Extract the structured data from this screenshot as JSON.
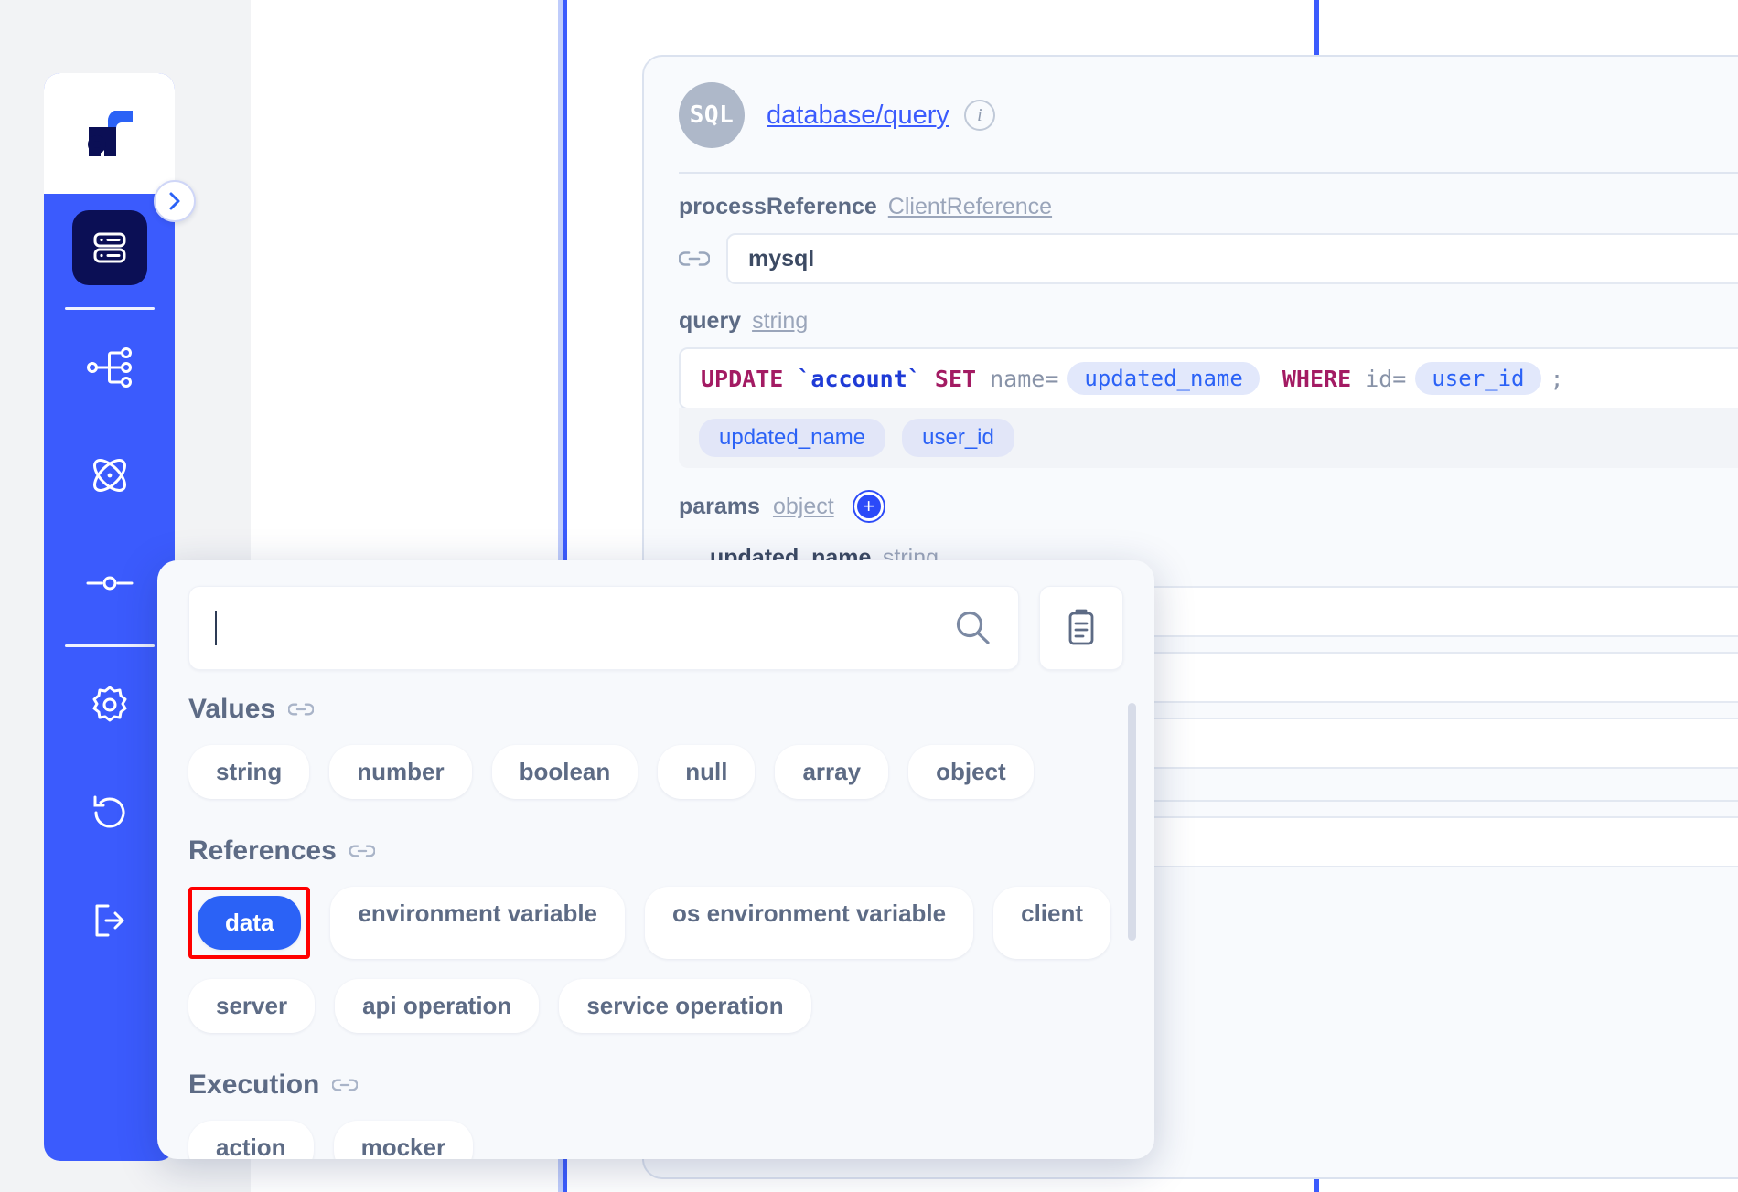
{
  "sidebar": {
    "logo_alt": "app-logo",
    "expand_label": "›",
    "items": [
      {
        "id": "database",
        "icon": "database-icon",
        "active": true
      },
      {
        "id": "flow",
        "icon": "flow-graph-icon",
        "active": false
      },
      {
        "id": "atom",
        "icon": "atom-icon",
        "active": false
      },
      {
        "id": "node",
        "icon": "node-connector-icon",
        "active": false
      },
      {
        "id": "settings",
        "icon": "gear-icon",
        "active": false
      },
      {
        "id": "history",
        "icon": "history-undo-icon",
        "active": false
      },
      {
        "id": "logout",
        "icon": "logout-icon",
        "active": false
      }
    ]
  },
  "node_card": {
    "badge": "SQL",
    "title": "database/query",
    "info_icon": "info-icon",
    "toggle_on": true,
    "menu_icon": "kebab-menu-icon",
    "fields": {
      "process_reference": {
        "label": "processReference",
        "type": "ClientReference",
        "value": "mysql",
        "link_icon": "link-icon"
      },
      "query": {
        "label": "query",
        "type": "string",
        "tokens": [
          {
            "t": "UPDATE",
            "k": "kw"
          },
          {
            "t": " ",
            "k": "sp"
          },
          {
            "t": "`account`",
            "k": "tbl"
          },
          {
            "t": " ",
            "k": "sp"
          },
          {
            "t": "SET",
            "k": "kw"
          },
          {
            "t": " ",
            "k": "sp"
          },
          {
            "t": "name",
            "k": "id"
          },
          {
            "t": " = ",
            "k": "op"
          },
          {
            "t": "updated_name",
            "k": "chip"
          },
          {
            "t": " ",
            "k": "sp"
          },
          {
            "t": "WHERE",
            "k": "kw"
          },
          {
            "t": " ",
            "k": "sp"
          },
          {
            "t": "id",
            "k": "id"
          },
          {
            "t": " = ",
            "k": "op"
          },
          {
            "t": "user_id",
            "k": "chip"
          },
          {
            "t": ";",
            "k": "op"
          }
        ],
        "variables": [
          "updated_name",
          "user_id"
        ]
      },
      "params": {
        "label": "params",
        "type": "object",
        "add_label": "+",
        "collapse_icon": "chevron-down-icon",
        "children": [
          {
            "label": "updated_name",
            "type": "string"
          }
        ]
      }
    }
  },
  "popover": {
    "search": {
      "value": "",
      "placeholder": "",
      "icon": "search-icon"
    },
    "paste_button": {
      "icon": "clipboard-icon"
    },
    "sections": [
      {
        "title": "Values",
        "icon": "link-icon",
        "options": [
          {
            "label": "string",
            "selected": false
          },
          {
            "label": "number",
            "selected": false
          },
          {
            "label": "boolean",
            "selected": false
          },
          {
            "label": "null",
            "selected": false
          },
          {
            "label": "array",
            "selected": false
          },
          {
            "label": "object",
            "selected": false
          }
        ]
      },
      {
        "title": "References",
        "icon": "link-icon",
        "options": [
          {
            "label": "data",
            "selected": true,
            "highlighted": true
          },
          {
            "label": "environment variable",
            "selected": false
          },
          {
            "label": "os environment variable",
            "selected": false
          },
          {
            "label": "client",
            "selected": false
          },
          {
            "label": "server",
            "selected": false
          },
          {
            "label": "api operation",
            "selected": false
          },
          {
            "label": "service operation",
            "selected": false
          }
        ]
      },
      {
        "title": "Execution",
        "icon": "link-icon",
        "options": [
          {
            "label": "action",
            "selected": false
          },
          {
            "label": "mocker",
            "selected": false
          }
        ]
      }
    ]
  },
  "colors": {
    "brand_blue": "#3b5bfd",
    "rail_active": "#0b0f55",
    "accent": "#2b62f6",
    "highlight": "#ff0000",
    "keyword": "#a31b63",
    "table": "#1f3bd6",
    "muted": "#8893a8"
  }
}
